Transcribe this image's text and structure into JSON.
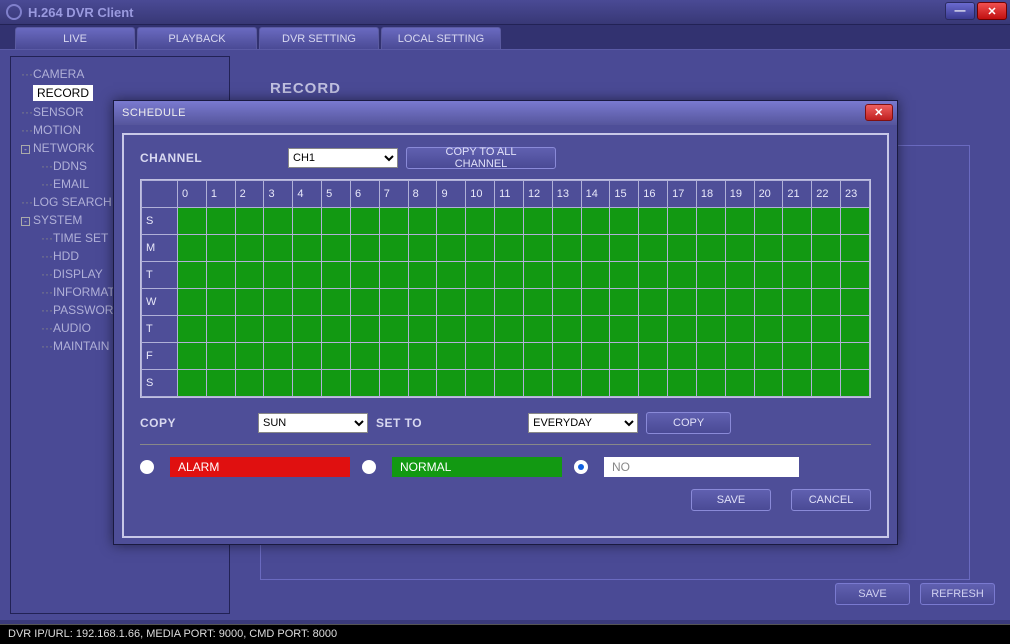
{
  "app": {
    "title": "H.264 DVR Client"
  },
  "tabs": [
    "LIVE",
    "PLAYBACK",
    "DVR SETTING",
    "LOCAL SETTING"
  ],
  "sidebar": {
    "items": [
      "CAMERA",
      "RECORD",
      "SENSOR",
      "MOTION",
      "NETWORK",
      "DDNS",
      "EMAIL",
      "LOG SEARCH",
      "SYSTEM",
      "TIME SET",
      "HDD",
      "DISPLAY",
      "INFORMATION",
      "PASSWORD",
      "AUDIO",
      "MAINTAIN"
    ]
  },
  "section": {
    "title": "RECORD"
  },
  "bg_buttons": {
    "save": "SAVE",
    "refresh": "REFRESH"
  },
  "dialog": {
    "title": "SCHEDULE",
    "channel_label": "CHANNEL",
    "channel_value": "CH1",
    "copy_all": "COPY TO ALL CHANNEL",
    "hours": [
      "0",
      "1",
      "2",
      "3",
      "4",
      "5",
      "6",
      "7",
      "8",
      "9",
      "10",
      "11",
      "12",
      "13",
      "14",
      "15",
      "16",
      "17",
      "18",
      "19",
      "20",
      "21",
      "22",
      "23"
    ],
    "days": [
      "S",
      "M",
      "T",
      "W",
      "T",
      "F",
      "S"
    ],
    "copy_label": "COPY",
    "copy_from": "SUN",
    "set_to_label": "SET TO",
    "set_to": "EVERYDAY",
    "copy_btn": "COPY",
    "legend": {
      "alarm": "ALARM",
      "normal": "NORMAL",
      "no": "NO"
    },
    "save": "SAVE",
    "cancel": "CANCEL"
  },
  "status": "DVR IP/URL: 192.168.1.66, MEDIA PORT: 9000, CMD PORT: 8000"
}
